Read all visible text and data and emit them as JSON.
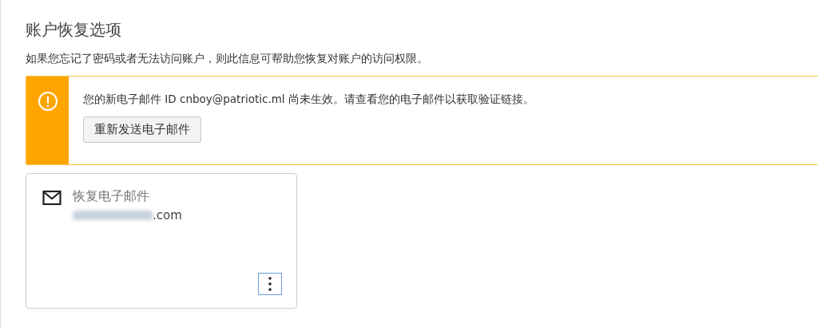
{
  "title": "账户恢复选项",
  "description": "如果您忘记了密码或者无法访问账户，则此信息可帮助您恢复对账户的访问权限。",
  "alert": {
    "message": "您的新电子邮件 ID cnboy@patriotic.ml 尚未生效。请查看您的电子邮件以获取验证链接。",
    "button": "重新发送电子邮件"
  },
  "cards": [
    {
      "title": "恢复电子邮件",
      "value": ".com",
      "redacted": true
    }
  ]
}
